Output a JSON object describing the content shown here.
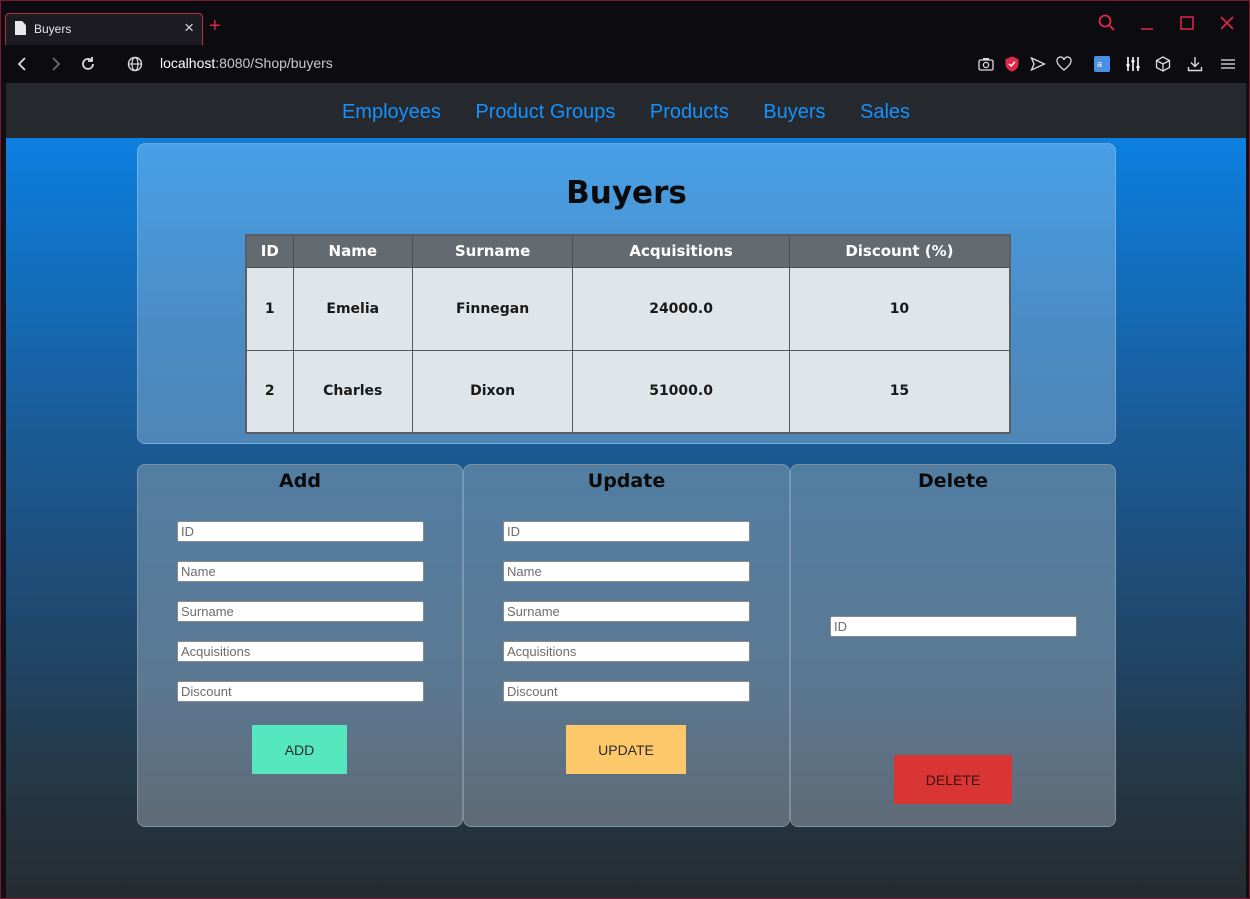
{
  "browser": {
    "tab_title": "Buyers",
    "url_host": "localhost",
    "url_rest": ":8080/Shop/buyers"
  },
  "nav": {
    "items": [
      "Employees",
      "Product Groups",
      "Products",
      "Buyers",
      "Sales"
    ]
  },
  "page": {
    "title": "Buyers"
  },
  "table": {
    "columns": [
      "ID",
      "Name",
      "Surname",
      "Acquisitions",
      "Discount (%)"
    ],
    "rows": [
      [
        "1",
        "Emelia",
        "Finnegan",
        "24000.0",
        "10"
      ],
      [
        "2",
        "Charles",
        "Dixon",
        "51000.0",
        "15"
      ]
    ]
  },
  "add_form": {
    "title": "Add",
    "placeholders": [
      "ID",
      "Name",
      "Surname",
      "Acquisitions",
      "Discount"
    ],
    "button": "ADD"
  },
  "update_form": {
    "title": "Update",
    "placeholders": [
      "ID",
      "Name",
      "Surname",
      "Acquisitions",
      "Discount"
    ],
    "button": "UPDATE"
  },
  "delete_form": {
    "title": "Delete",
    "placeholder": "ID",
    "button": "DELETE"
  },
  "colors": {
    "nav_link": "#1592ff",
    "add_button": "#55e8bf",
    "update_button": "#fdc86a",
    "delete_button": "#d93535",
    "browser_accent": "#e0284a"
  }
}
